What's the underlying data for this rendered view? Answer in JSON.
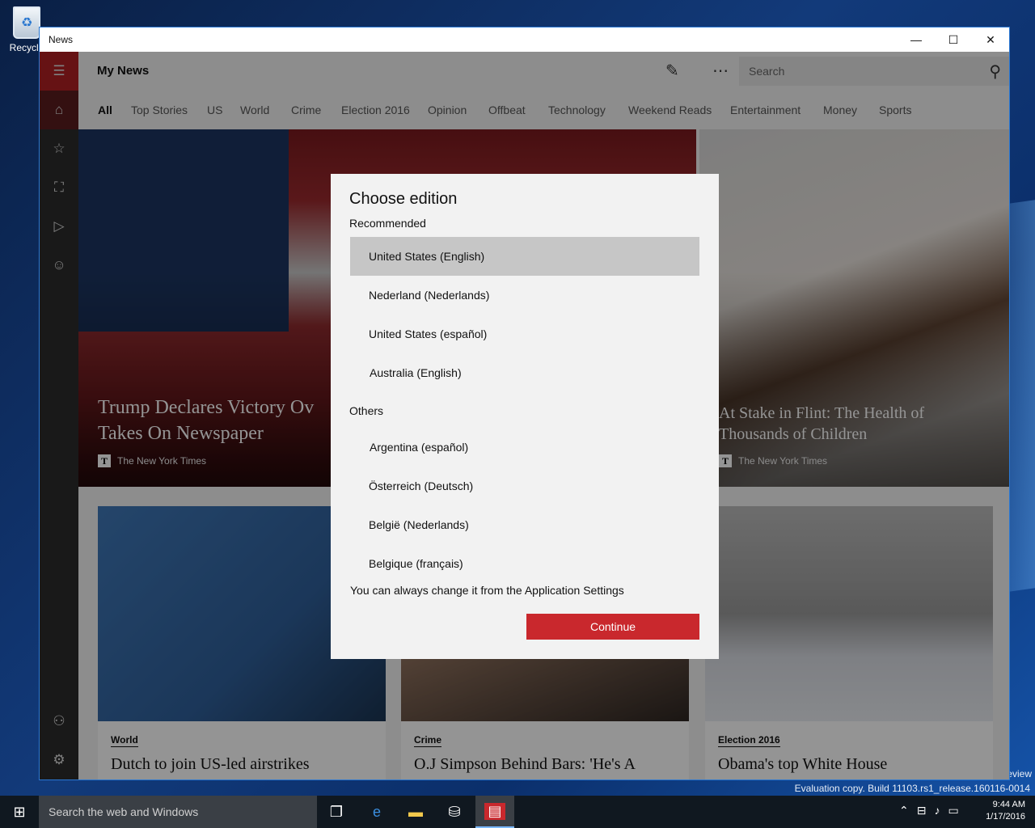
{
  "desktop": {
    "recycle_label": "Recycle",
    "watermark_line1": "eview",
    "watermark_line2": "Evaluation copy. Build 11103.rs1_release.160116-0014"
  },
  "window": {
    "title": "News",
    "controls": {
      "minimize": "—",
      "maximize": "☐",
      "close": "✕"
    }
  },
  "header": {
    "title": "My News",
    "search_placeholder": "Search"
  },
  "tabs": [
    "All",
    "Top Stories",
    "US",
    "World",
    "Crime",
    "Election 2016",
    "Opinion",
    "Offbeat",
    "Technology",
    "Weekend Reads",
    "Entertainment",
    "Money",
    "Sports"
  ],
  "hero": {
    "left": {
      "headline_line1": "Trump Declares Victory Ov",
      "headline_line2": "Takes On Newspaper",
      "source": "The New York Times"
    },
    "right": {
      "headline_line1": "At Stake in Flint: The Health of",
      "headline_line2": "Thousands of Children",
      "source": "The New York Times"
    }
  },
  "cards": [
    {
      "category": "World",
      "headline": "Dutch to join US-led airstrikes"
    },
    {
      "category": "Crime",
      "headline": "O.J Simpson Behind Bars: 'He's A"
    },
    {
      "category": "Election 2016",
      "headline": "Obama's top White House"
    }
  ],
  "dialog": {
    "title": "Choose edition",
    "recommended_label": "Recommended",
    "recommended": [
      "United States (English)",
      "Nederland (Nederlands)",
      "United States (español)",
      "Australia (English)"
    ],
    "others_label": "Others",
    "others": [
      "Argentina (español)",
      "Österreich (Deutsch)",
      "België (Nederlands)",
      "Belgique (français)"
    ],
    "note": "You can always change it from the Application Settings",
    "continue_label": "Continue",
    "selected": "United States (English)"
  },
  "taskbar": {
    "search_placeholder": "Search the web and Windows",
    "time": "9:44 AM",
    "date": "1/17/2016"
  },
  "colors": {
    "accent": "#c9282d",
    "rail": "#2b2b2b",
    "selected_option": "#c6c6c6"
  }
}
